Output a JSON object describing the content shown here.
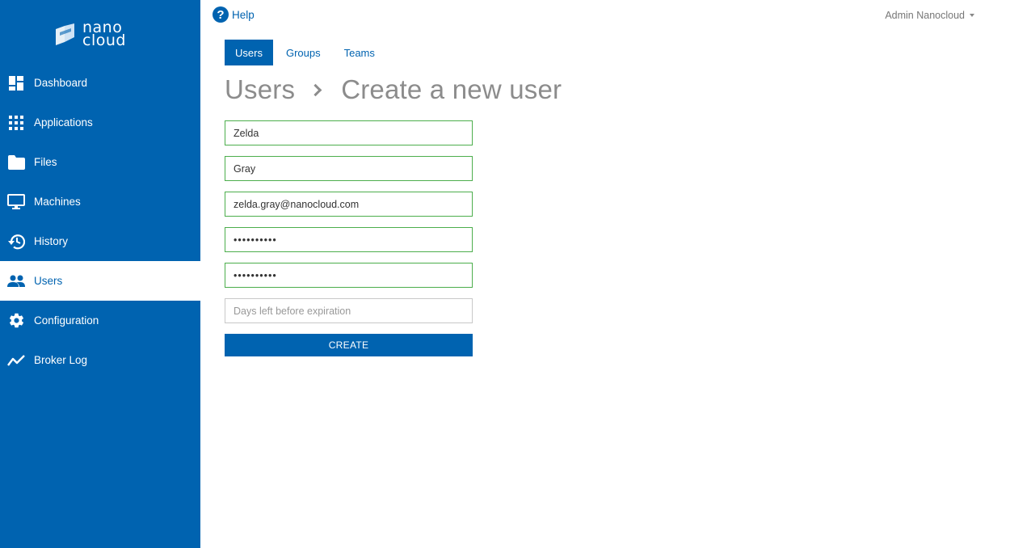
{
  "brand": {
    "line1": "nano",
    "line2": "cloud"
  },
  "sidebar": {
    "items": [
      {
        "label": "Dashboard",
        "icon": "dashboard-icon"
      },
      {
        "label": "Applications",
        "icon": "apps-grid-icon"
      },
      {
        "label": "Files",
        "icon": "folder-icon"
      },
      {
        "label": "Machines",
        "icon": "monitor-icon"
      },
      {
        "label": "History",
        "icon": "history-icon"
      },
      {
        "label": "Users",
        "icon": "users-icon",
        "active": true
      },
      {
        "label": "Configuration",
        "icon": "gear-icon"
      },
      {
        "label": "Broker Log",
        "icon": "line-chart-icon"
      }
    ]
  },
  "header": {
    "help_label": "Help",
    "user_menu_label": "Admin Nanocloud"
  },
  "tabs": [
    {
      "label": "Users",
      "active": true
    },
    {
      "label": "Groups"
    },
    {
      "label": "Teams"
    }
  ],
  "breadcrumb": {
    "parent": "Users",
    "current": "Create a new user"
  },
  "form": {
    "first_name": "Zelda",
    "last_name": "Gray",
    "email": "zelda.gray@nanocloud.com",
    "password": "••••••••••",
    "password_confirm": "••••••••••",
    "expiration_placeholder": "Days left before expiration",
    "create_label": "CREATE"
  },
  "colors": {
    "primary": "#0063b0",
    "valid_border": "#4cae4c",
    "title_gray": "#8c8c8c"
  }
}
